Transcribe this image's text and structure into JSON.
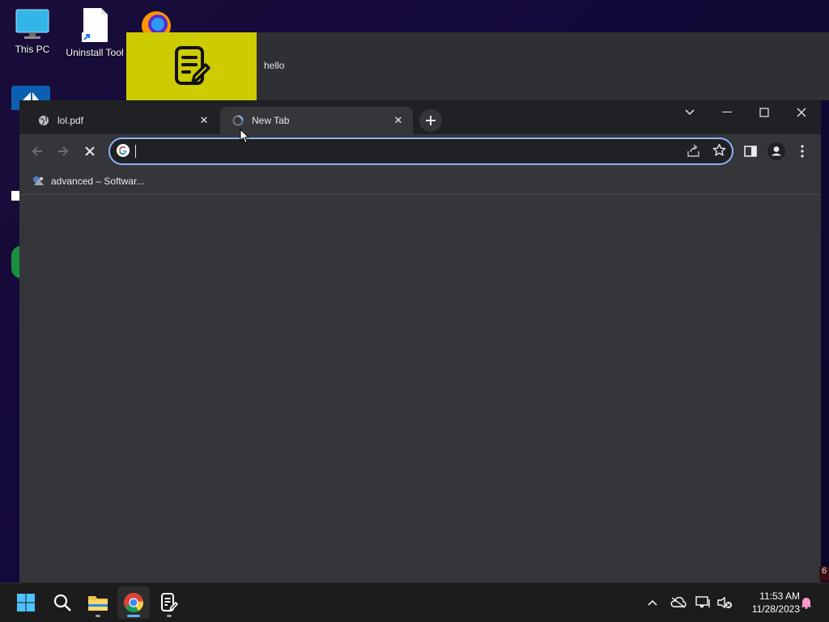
{
  "desktop": {
    "icons": [
      {
        "label": "This PC",
        "icon": "monitor-icon"
      },
      {
        "label": "Uninstall Tool",
        "icon": "shortcut-file-icon"
      },
      {
        "label": "",
        "icon": "firefox-icon"
      }
    ]
  },
  "notepad": {
    "text": "hello",
    "icon": "notepad-icon",
    "tile_color": "#cccc00"
  },
  "browser": {
    "tabs": [
      {
        "title": "lol.pdf",
        "icon": "globe-icon",
        "active": false
      },
      {
        "title": "New Tab",
        "icon": "loading-icon",
        "active": true
      }
    ],
    "omnibox": {
      "value": "",
      "placeholder": "",
      "icon": "google-icon"
    },
    "bookmarks": [
      {
        "label": "advanced – Softwar...",
        "icon": "bookmark-favicon-icon"
      }
    ],
    "accent": "#8ab4f8",
    "theme_bg": "#35363a"
  },
  "taskbar": {
    "apps": [
      {
        "name": "start",
        "icon": "windows-icon"
      },
      {
        "name": "search",
        "icon": "search-icon"
      },
      {
        "name": "file-explorer",
        "icon": "folder-icon"
      },
      {
        "name": "chrome",
        "icon": "chrome-icon"
      },
      {
        "name": "notepad",
        "icon": "notepad-icon"
      }
    ],
    "clock": {
      "time": "11:53 AM",
      "date": "11/28/2023"
    },
    "edge_badge": "6"
  }
}
